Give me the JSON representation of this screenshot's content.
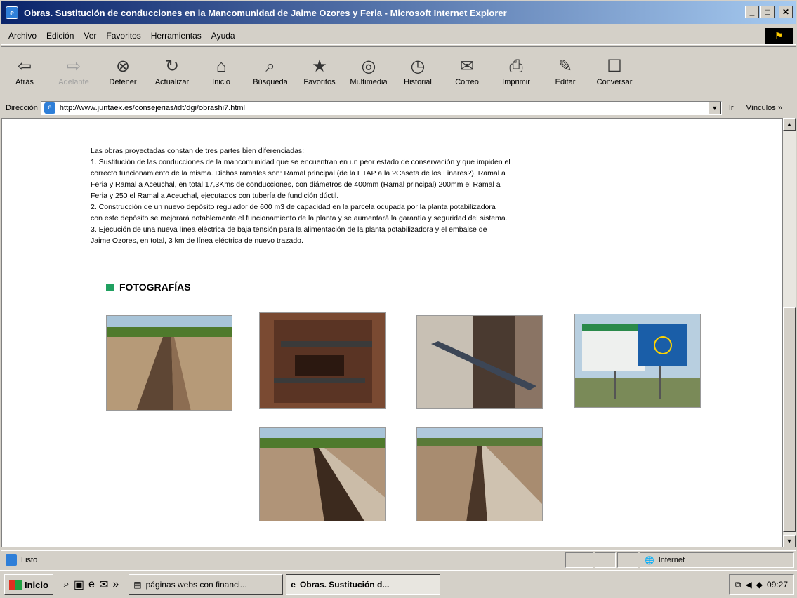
{
  "window": {
    "title": "Obras. Sustitución de conducciones en la Mancomunidad de Jaime Ozores y Feria - Microsoft Internet Explorer",
    "min": "_",
    "max": "□",
    "close": "✕"
  },
  "menu": {
    "items": [
      "Archivo",
      "Edición",
      "Ver",
      "Favoritos",
      "Herramientas",
      "Ayuda"
    ]
  },
  "toolbar": {
    "items": [
      {
        "label": "Atrás",
        "icon": "⇦"
      },
      {
        "label": "Adelante",
        "icon": "⇨"
      },
      {
        "label": "Detener",
        "icon": "⊗"
      },
      {
        "label": "Actualizar",
        "icon": "↻"
      },
      {
        "label": "Inicio",
        "icon": "⌂"
      },
      {
        "label": "Búsqueda",
        "icon": "⌕"
      },
      {
        "label": "Favoritos",
        "icon": "★"
      },
      {
        "label": "Multimedia",
        "icon": "◎"
      },
      {
        "label": "Historial",
        "icon": "◷"
      },
      {
        "label": "Correo",
        "icon": "✉"
      },
      {
        "label": "Imprimir",
        "icon": "⎙"
      },
      {
        "label": "Editar",
        "icon": "✎"
      },
      {
        "label": "Conversar",
        "icon": "☐"
      }
    ]
  },
  "address": {
    "label": "Dirección",
    "url": "http://www.juntaex.es/consejerias/idt/dgi/obrashi7.html",
    "go": "Ir",
    "links": "Vínculos »"
  },
  "content": {
    "lines": [
      "Las obras proyectadas constan de tres partes bien diferenciadas:",
      "1. Sustitución de las conducciones de la mancomunidad que se encuentran en un peor estado de conservación y que impiden el",
      "correcto funcionamiento de la misma. Dichos ramales son: Ramal principal (de la ETAP a la ?Caseta de los Linares?), Ramal a",
      "Feria y Ramal a Aceuchal, en total 17,3Kms de conducciones, con diámetros de 400mm (Ramal principal) 200mm el Ramal a",
      "Feria y 250 el Ramal a Aceuchal, ejecutados con tubería de fundición dúctil.",
      "2. Construcción de un nuevo depósito regulador de 600 m3 de capacidad en la parcela ocupada por la planta potabilizadora",
      "con este depósito se mejorará notablemente el funcionamiento de la planta y se aumentará la garantía y seguridad del sistema.",
      "3. Ejecución de una nueva línea eléctrica de baja tensión para la alimentación de la planta potabilizadora y el embalse de",
      "Jaime Ozores, en total, 3 km de línea eléctrica de nuevo trazado."
    ],
    "photos_heading": "FOTOGRAFÍAS"
  },
  "status": {
    "text": "Listo",
    "zone": "Internet"
  },
  "taskbar": {
    "start": "Inicio",
    "tasks": [
      "páginas webs con financi...",
      "Obras. Sustitución d..."
    ],
    "clock": "09:27"
  }
}
